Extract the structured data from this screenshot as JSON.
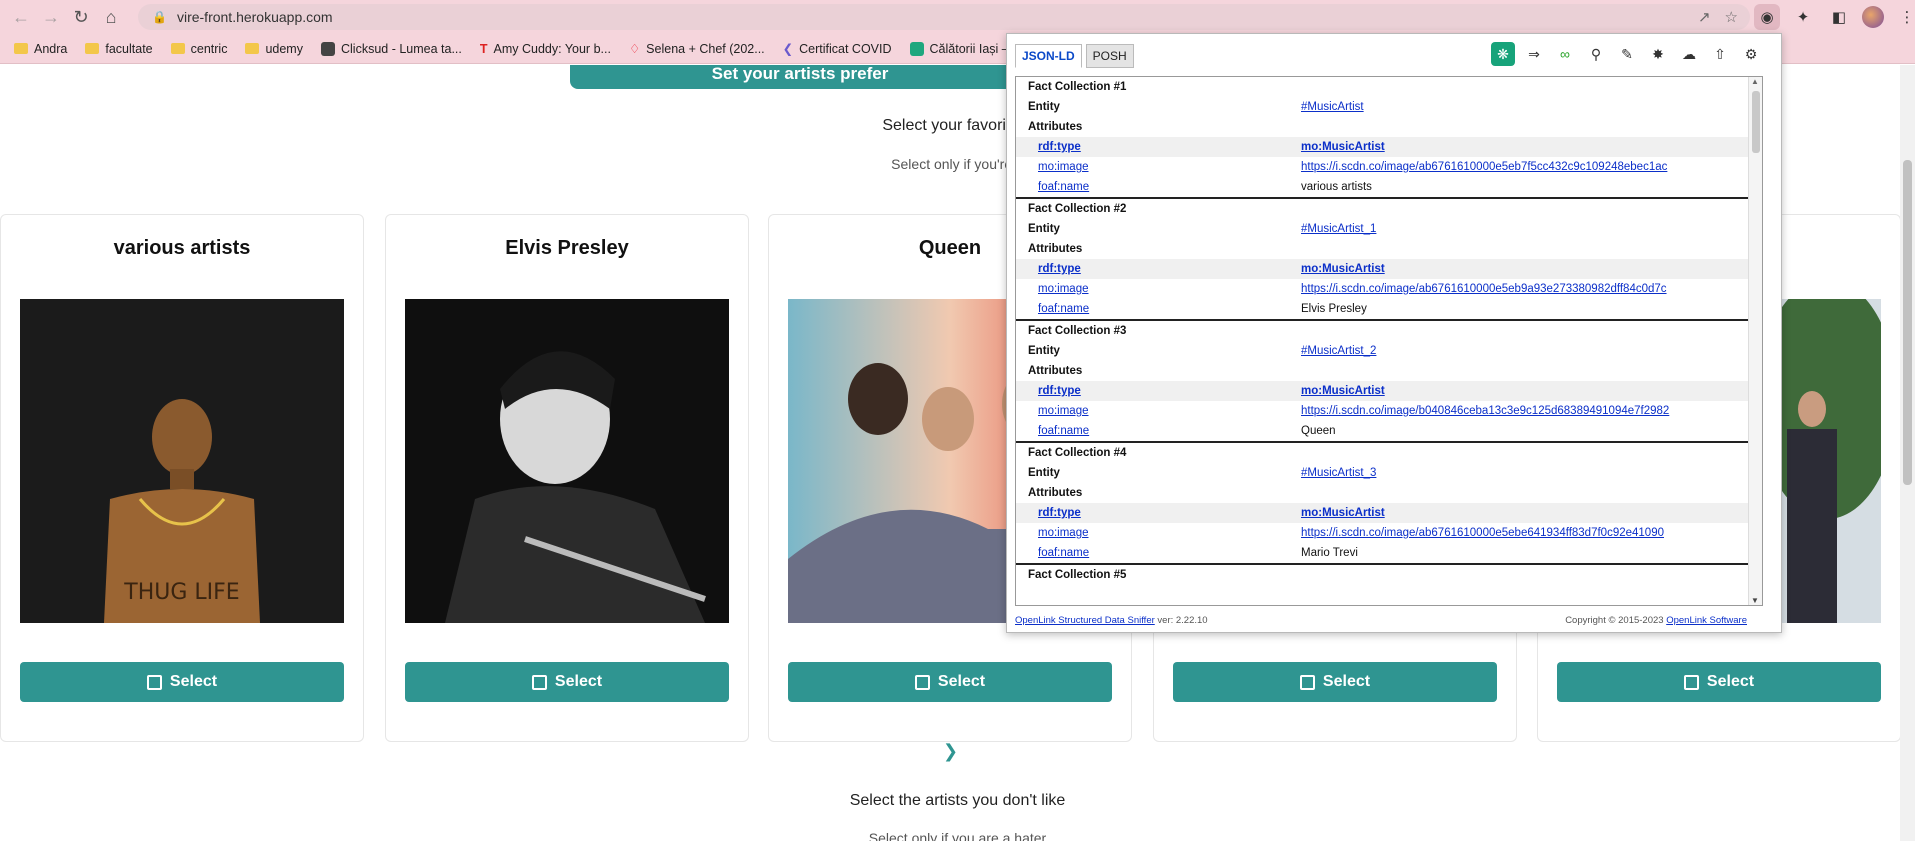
{
  "browser": {
    "url": "vire-front.herokuapp.com",
    "bookmarks": [
      "Andra",
      "facultate",
      "centric",
      "udemy",
      "Clicksud - Lumea ta...",
      "Amy Cuddy: Your b...",
      "Selena + Chef (202...",
      "Certificat COVID",
      "Călătorii Iași – E"
    ]
  },
  "page": {
    "banner": "Set your artists prefer",
    "section1_title": "Select your favorite a",
    "section1_sub": "Select only if you're a",
    "section2_title": "Select the artists you don't like",
    "section2_sub": "Select only if you are a hater",
    "select_label": "Select",
    "cards": [
      {
        "name": "various artists"
      },
      {
        "name": "Elvis Presley"
      },
      {
        "name": "Queen"
      },
      {
        "name": ""
      },
      {
        "name": ""
      }
    ]
  },
  "popup": {
    "tabs": [
      "JSON-LD",
      "POSH"
    ],
    "labels": {
      "entity": "Entity",
      "attributes": "Attributes"
    },
    "collections": [
      {
        "title": "Fact Collection #1",
        "entity": "#MusicArtist",
        "type_key": "rdf:type",
        "type_val": "mo:MusicArtist",
        "image_key": "mo:image",
        "image_val": "https://i.scdn.co/image/ab6761610000e5eb7f5cc432c9c109248ebec1ac",
        "name_key": "foaf:name",
        "name_val": "various artists"
      },
      {
        "title": "Fact Collection #2",
        "entity": "#MusicArtist_1",
        "type_key": "rdf:type",
        "type_val": "mo:MusicArtist",
        "image_key": "mo:image",
        "image_val": "https://i.scdn.co/image/ab6761610000e5eb9a93e273380982dff84c0d7c",
        "name_key": "foaf:name",
        "name_val": "Elvis Presley"
      },
      {
        "title": "Fact Collection #3",
        "entity": "#MusicArtist_2",
        "type_key": "rdf:type",
        "type_val": "mo:MusicArtist",
        "image_key": "mo:image",
        "image_val": "https://i.scdn.co/image/b040846ceba13c3e9c125d68389491094e7f2982",
        "name_key": "foaf:name",
        "name_val": "Queen"
      },
      {
        "title": "Fact Collection #4",
        "entity": "#MusicArtist_3",
        "type_key": "rdf:type",
        "type_val": "mo:MusicArtist",
        "image_key": "mo:image",
        "image_val": "https://i.scdn.co/image/ab6761610000e5ebe641934ff83d7f0c92e41090",
        "name_key": "foaf:name",
        "name_val": "Mario Trevi"
      }
    ],
    "partial_title": "Fact Collection #5",
    "footer_link": "OpenLink Structured Data Sniffer",
    "footer_version": "ver: 2.22.10",
    "footer_copyright": "Copyright © 2015-2023",
    "footer_company": "OpenLink Software"
  },
  "colors": {
    "accent": "#2f9591",
    "chrome": "#f5d5dc",
    "link": "#0b2fc9"
  }
}
